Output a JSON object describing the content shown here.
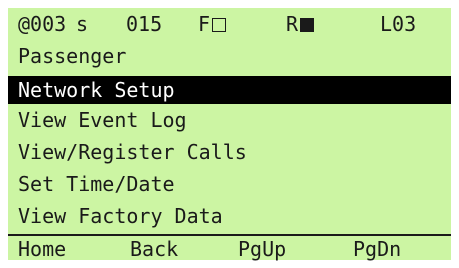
{
  "status": {
    "address": "@003",
    "mode": "s",
    "count": "015",
    "f_label": "F",
    "f_state": "off",
    "r_label": "R",
    "r_state": "on",
    "level": "L03"
  },
  "title": "Passenger",
  "menu": [
    {
      "label": "Network Setup",
      "selected": true
    },
    {
      "label": "View Event Log",
      "selected": false
    },
    {
      "label": "View/Register Calls",
      "selected": false
    },
    {
      "label": "Set Time/Date",
      "selected": false
    },
    {
      "label": "View Factory Data",
      "selected": false
    }
  ],
  "softkeys": [
    "Home",
    "Back",
    "PgUp",
    "PgDn"
  ],
  "colors": {
    "screen_bg": "#ccf5a3",
    "text": "#1a1a1a",
    "highlight_bg": "#000000",
    "highlight_text": "#ffffff"
  }
}
